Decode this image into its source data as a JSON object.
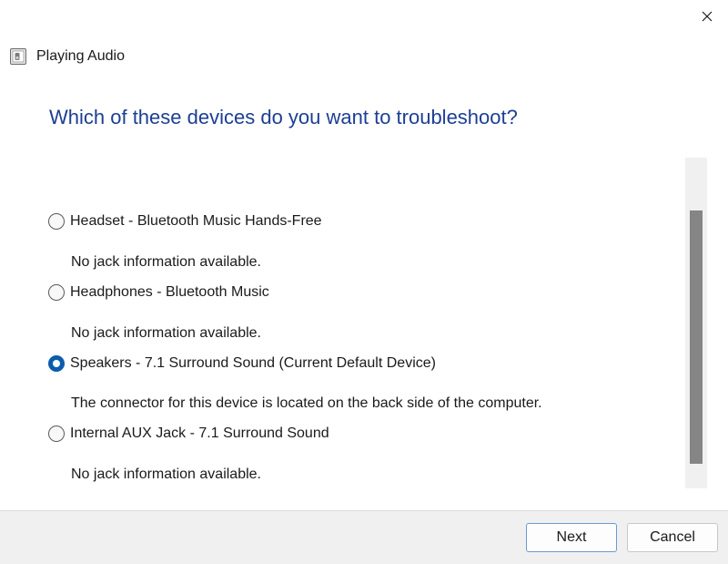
{
  "window": {
    "title": "Playing Audio",
    "close_glyph": "✕"
  },
  "heading": "Which of these devices do you want to troubleshoot?",
  "devices": [
    {
      "label": "Headset - Bluetooth Music Hands-Free",
      "description": "No jack information available.",
      "selected": false
    },
    {
      "label": "Headphones - Bluetooth Music",
      "description": "No jack information available.",
      "selected": false
    },
    {
      "label": "Speakers - 7.1 Surround Sound (Current Default Device)",
      "description": "The connector for this device is located on the back side of the computer.",
      "selected": true
    },
    {
      "label": "Internal AUX Jack - 7.1 Surround Sound",
      "description": "No jack information available.",
      "selected": false
    }
  ],
  "buttons": {
    "next_label": "Next",
    "cancel_label": "Cancel"
  },
  "colors": {
    "heading": "#1c3f94",
    "accent": "#0b5cad",
    "footer_bg": "#f0f0f0"
  },
  "icons": {
    "app": "speaker-icon",
    "close": "close-icon"
  }
}
